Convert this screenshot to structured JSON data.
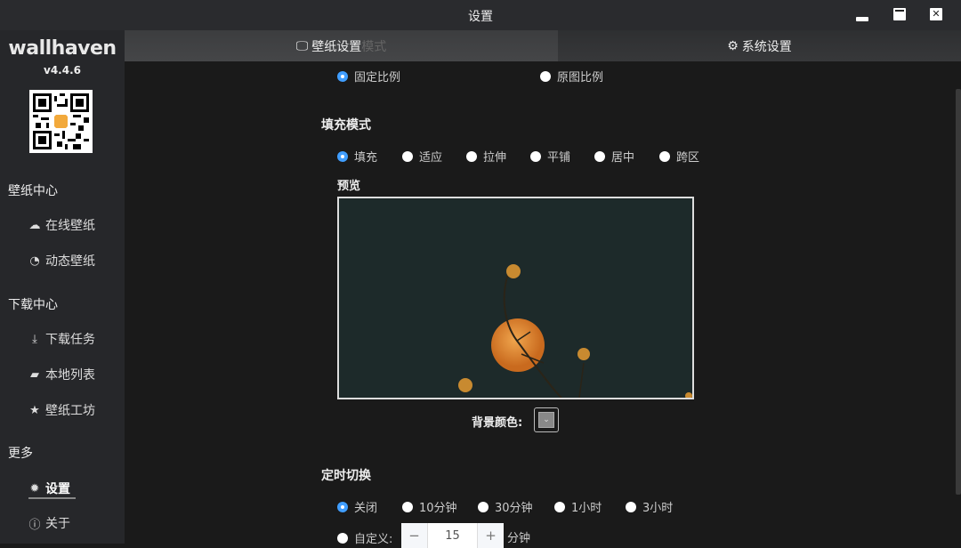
{
  "window": {
    "title": "设置"
  },
  "sidebar": {
    "logo": "wallhaven",
    "version": "v4.4.6",
    "sections": [
      {
        "label": "壁纸中心",
        "items": [
          {
            "label": "在线壁纸",
            "icon": "cloud-icon"
          },
          {
            "label": "动态壁纸",
            "icon": "gauge-icon"
          }
        ]
      },
      {
        "label": "下载中心",
        "items": [
          {
            "label": "下载任务",
            "icon": "download-icon"
          },
          {
            "label": "本地列表",
            "icon": "folder-icon"
          },
          {
            "label": "壁纸工坊",
            "icon": "sparkle-star-icon"
          }
        ]
      },
      {
        "label": "更多",
        "items": [
          {
            "label": "设置",
            "icon": "gear-icon",
            "active": true
          },
          {
            "label": "关于",
            "icon": "info-icon"
          }
        ]
      }
    ]
  },
  "tabs": [
    {
      "label": "壁纸设置",
      "icon": "monitor-icon",
      "active": true,
      "ghost": "模式"
    },
    {
      "label": "系统设置",
      "icon": "gear-icon"
    }
  ],
  "ratio": {
    "options": [
      "固定比例",
      "原图比例"
    ],
    "selected": "固定比例"
  },
  "fill_mode": {
    "title": "填充模式",
    "options": [
      "填充",
      "适应",
      "拉伸",
      "平铺",
      "居中",
      "跨区"
    ],
    "selected": "填充",
    "preview_label": "预览",
    "bg_color_label": "背景颜色:",
    "bg_color": "#888888"
  },
  "timer": {
    "title": "定时切换",
    "options": [
      "关闭",
      "10分钟",
      "30分钟",
      "1小时",
      "3小时"
    ],
    "selected": "关闭",
    "custom_label": "自定义:",
    "custom_value": "15",
    "minus": "−",
    "plus": "+",
    "unit": "分钟"
  },
  "colors": {
    "accent": "#409eff",
    "background": "#1a1a1a",
    "sidebar": "#26272a"
  }
}
